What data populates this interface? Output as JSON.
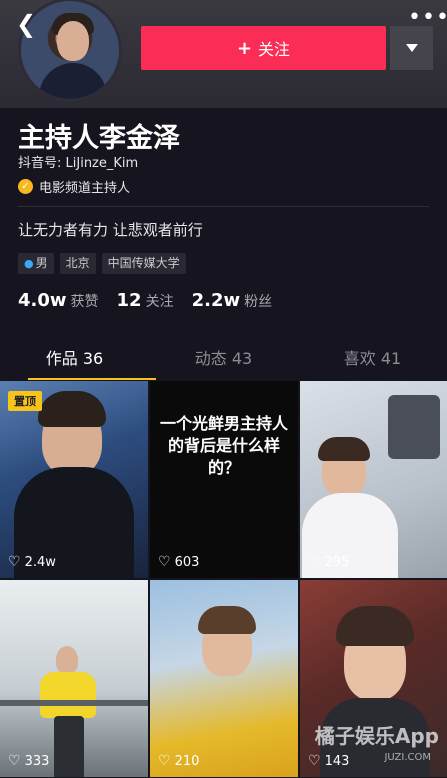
{
  "header": {
    "back_icon": "back-chevron-icon",
    "follow_label": "关注",
    "more_icon": "more-dots-icon"
  },
  "profile": {
    "name": "主持人李金泽",
    "douyin_id": "抖音号: LiJinze_Kim",
    "verified_label": "电影频道主持人",
    "bio": "让无力者有力 让悲观者前行",
    "tags": [
      "男",
      "北京",
      "中国传媒大学"
    ],
    "stats": [
      {
        "num": "4.0w",
        "label": "获赞"
      },
      {
        "num": "12",
        "label": "关注"
      },
      {
        "num": "2.2w",
        "label": "粉丝"
      }
    ]
  },
  "tabs": [
    {
      "label": "作品 36"
    },
    {
      "label": "动态 43"
    },
    {
      "label": "喜欢 41"
    }
  ],
  "videos": [
    {
      "likes": "2.4w",
      "pinned": "置顶"
    },
    {
      "likes": "603",
      "text": "一个光鲜男主持人的背后是什么样的？"
    },
    {
      "likes": "295"
    },
    {
      "likes": "333"
    },
    {
      "likes": "210"
    },
    {
      "likes": "143"
    }
  ],
  "watermark": {
    "title": "橘子娱乐App",
    "site": "JUZI.COM"
  },
  "colors": {
    "accent": "#fb2c55",
    "tab_underline": "#f8c31a",
    "background": "#16151f"
  }
}
